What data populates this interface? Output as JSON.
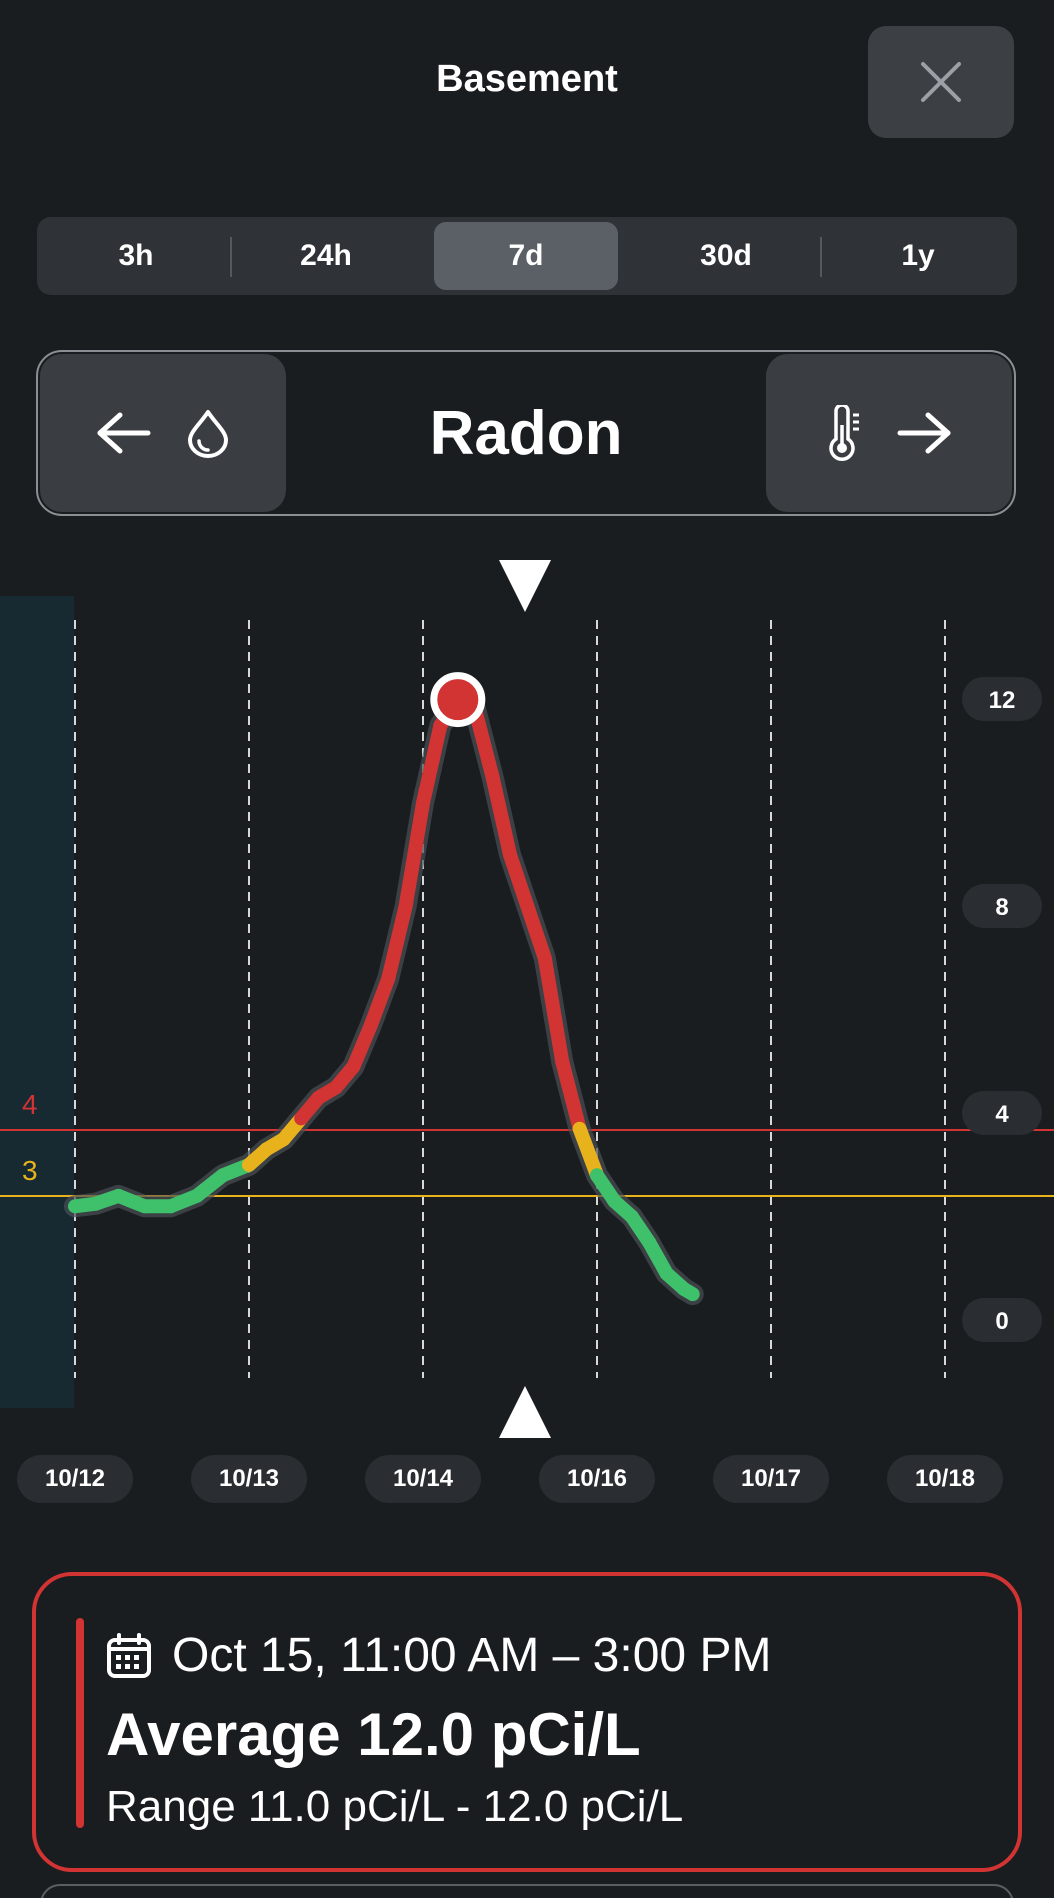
{
  "header": {
    "title": "Basement",
    "close_icon": "close-icon"
  },
  "time_ranges": {
    "options": [
      "3h",
      "24h",
      "7d",
      "30d",
      "1y"
    ],
    "selected": "7d"
  },
  "metric_selector": {
    "current": "Radon",
    "prev_icon": "humidity-drop-icon",
    "next_icon": "thermometer-icon"
  },
  "chart_data": {
    "type": "line",
    "x_tick_labels": [
      "10/12",
      "10/13",
      "10/14",
      "10/16",
      "10/17",
      "10/18"
    ],
    "y_tick_labels": [
      "12",
      "8",
      "4",
      "0"
    ],
    "ylim": [
      0,
      12
    ],
    "threshold_labels": {
      "red": "4",
      "yellow": "3"
    },
    "thresholds": [
      {
        "label": "4",
        "value": 4,
        "color": "#d23333"
      },
      {
        "label": "3",
        "value": 3,
        "color": "#e8b21c"
      }
    ],
    "series": [
      {
        "x": [
          0.0,
          0.12,
          0.25,
          0.4,
          0.55,
          0.7,
          0.85,
          1.0,
          1.1,
          1.2,
          1.3,
          1.4,
          1.5,
          1.6,
          1.7,
          1.8,
          1.9,
          2.0,
          2.1,
          2.2,
          2.3,
          2.4,
          2.5,
          2.6,
          2.7,
          2.8,
          2.9,
          3.0,
          3.1,
          3.2,
          3.3,
          3.4,
          3.5,
          3.55
        ],
        "y": [
          2.2,
          2.25,
          2.4,
          2.2,
          2.2,
          2.4,
          2.8,
          3.0,
          3.3,
          3.5,
          3.9,
          4.3,
          4.5,
          4.9,
          5.7,
          6.6,
          8.0,
          10.0,
          11.5,
          12.0,
          11.8,
          10.5,
          9.0,
          8.0,
          7.0,
          5.0,
          3.7,
          2.8,
          2.3,
          2.0,
          1.5,
          0.9,
          0.6,
          0.5
        ]
      }
    ],
    "color_scale": [
      {
        "below": 3,
        "color": "#3fc06a"
      },
      {
        "below": 4,
        "color": "#e8b21c"
      },
      {
        "below": 999,
        "color": "#d23333"
      }
    ],
    "selected_point": {
      "x": 2.2,
      "y": 12.0
    }
  },
  "summary": {
    "date_range": "Oct 15, 11:00 AM – 3:00 PM",
    "average": "Average 12.0 pCi/L",
    "range": "Range 11.0 pCi/L - 12.0 pCi/L",
    "calendar_icon": "calendar-icon",
    "accent_color": "#d23333"
  }
}
